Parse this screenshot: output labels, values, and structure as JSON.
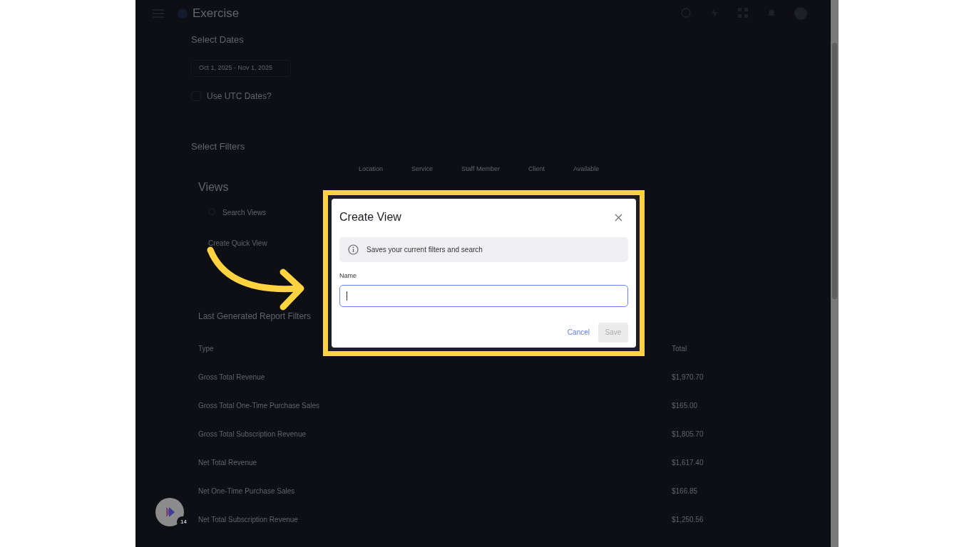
{
  "app": {
    "title": "Exercise"
  },
  "dates": {
    "heading": "Select Dates",
    "date_range": "Oct 1, 2025 - Nov 1, 2025",
    "utc_label": "Use UTC Dates?",
    "utc_checked": false
  },
  "filters": {
    "heading": "Select Filters",
    "items": [
      "Location",
      "Service",
      "Staff Member",
      "Client",
      "Available"
    ]
  },
  "views": {
    "heading": "Views",
    "search_placeholder": "Search Views",
    "quick_view": "Create Quick View"
  },
  "report": {
    "heading": "Last Generated Report Filters",
    "columns": [
      "Type",
      "Total"
    ],
    "rows": [
      [
        "Gross Total Revenue",
        "$1,970.70"
      ],
      [
        "Gross Total One-Time Purchase Sales",
        "$165.00"
      ],
      [
        "Gross Total Subscription Revenue",
        "$1,805.70"
      ],
      [
        "Net Total Revenue",
        "$1,617.40"
      ],
      [
        "Net One-Time Purchase Sales",
        "$166.85"
      ],
      [
        "Net Total Subscription Revenue",
        "$1,250.56"
      ]
    ]
  },
  "dialog": {
    "title": "Create View",
    "info": "Saves your current filters and search",
    "name_label": "Name",
    "focused": true,
    "cancel": "Cancel",
    "save": {
      "label": "Save",
      "disabled": true
    }
  },
  "chat_badge": "14"
}
